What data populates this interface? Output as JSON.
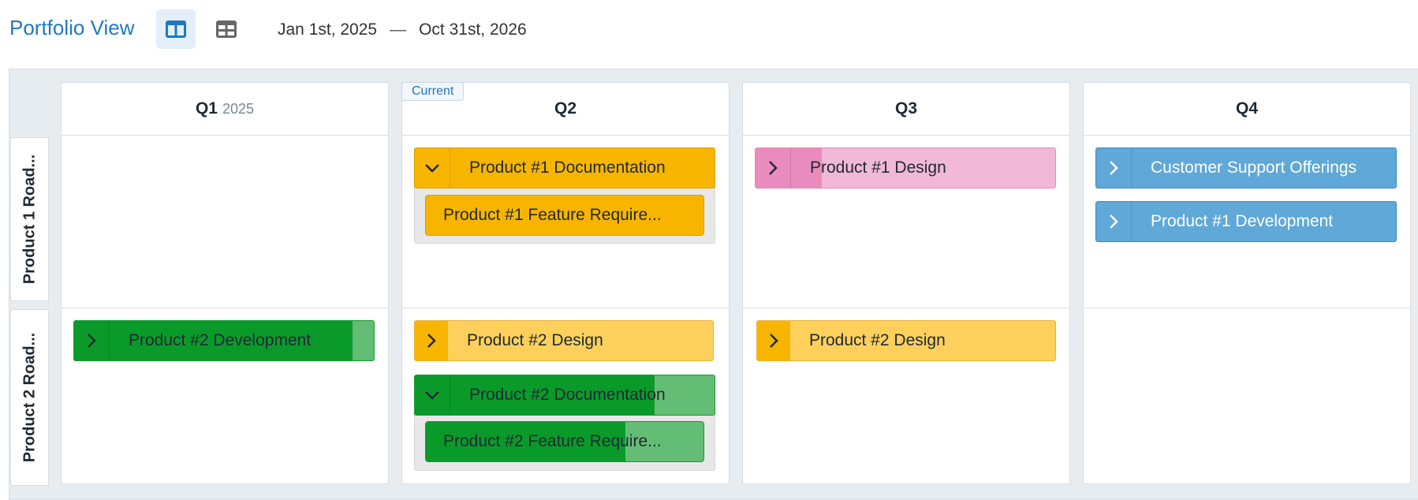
{
  "header": {
    "title": "Portfolio View",
    "date_start": "Jan 1st, 2025",
    "date_separator": "—",
    "date_end": "Oct 31st, 2026"
  },
  "icons": {
    "board_view": "columns-icon",
    "table_view": "grid-icon",
    "expanded": "chevron-down-icon",
    "collapsed": "chevron-right-icon"
  },
  "colors": {
    "accent": "#1f78c1",
    "orange": "#f8b500",
    "orange_light": "#fdd05c",
    "pink": "#f1b8d7",
    "blue": "#5fa8d8",
    "green": "#0a9a2a",
    "green_light": "#63bd74"
  },
  "columns": [
    {
      "label": "Q1",
      "year": "2025",
      "current": ""
    },
    {
      "label": "Q2",
      "year": "",
      "current": "Current"
    },
    {
      "label": "Q3",
      "year": "",
      "current": ""
    },
    {
      "label": "Q4",
      "year": "",
      "current": ""
    }
  ],
  "rows": [
    {
      "label": "Product 1 Road..."
    },
    {
      "label": "Product 2 Road..."
    }
  ],
  "cards": {
    "p1_documentation": {
      "label": "Product #1 Documentation",
      "expanded": true
    },
    "p1_feature_req": {
      "label": "Product #1 Feature Require..."
    },
    "p1_design": {
      "label": "Product #1 Design",
      "progress": 0.22
    },
    "customer_support": {
      "label": "Customer Support Offerings"
    },
    "p1_development": {
      "label": "Product #1 Development"
    },
    "p2_development": {
      "label": "Product #2 Development",
      "progress": 0.93
    },
    "p2_design_q2": {
      "label": "Product #2 Design"
    },
    "p2_design_q3": {
      "label": "Product #2 Design"
    },
    "p2_documentation": {
      "label": "Product #2 Documentation",
      "expanded": true,
      "progress": 0.8
    },
    "p2_feature_req": {
      "label": "Product #2 Feature Require...",
      "progress": 0.72
    }
  }
}
